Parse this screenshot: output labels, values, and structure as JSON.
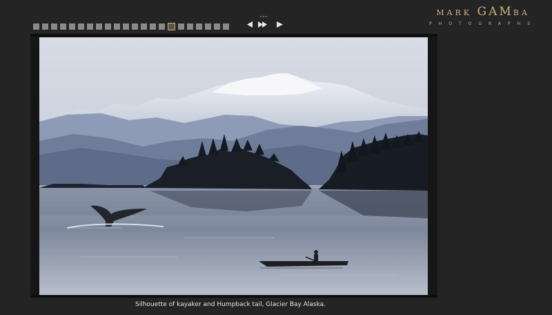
{
  "gallery": {
    "thumbnail_count": 22,
    "active_index": 15
  },
  "logo": {
    "name_part1": "MARK",
    "name_part2": "GAM",
    "name_part3": "BA",
    "subtitle": "PHOTOGRAPHS"
  },
  "photo": {
    "caption": "Silhouette of kayaker and Humpback tail, Glacier Bay Alaska."
  },
  "colors": {
    "background": "#242424",
    "accent": "#c8b57c"
  }
}
